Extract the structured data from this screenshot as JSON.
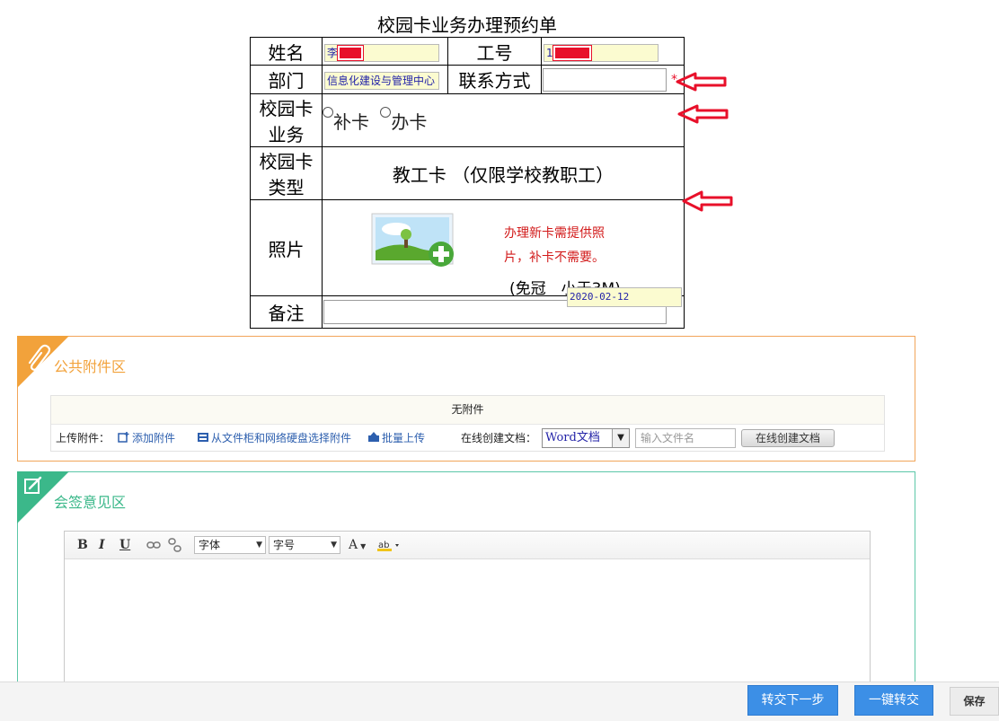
{
  "form": {
    "title": "校园卡业务办理预约单",
    "name_label": "姓名",
    "name_value": "李",
    "id_label": "工号",
    "id_value": "1",
    "dept_label": "部门",
    "dept_value": "信息化建设与管理中心",
    "contact_label": "联系方式",
    "contact_value": "",
    "required_mark": "*",
    "business_label": "校园卡业务",
    "business_options": [
      "补卡",
      "办卡"
    ],
    "type_label": "校园卡类型",
    "type_value": "教工卡 （仅限学校教职工）",
    "photo_label": "照片",
    "photo_note_line1": "办理新卡需提供照",
    "photo_note_line2": "片，补卡不需要。",
    "photo_hint": "(免冠　小于3M)",
    "remark_label": "备注",
    "remark_value": "",
    "date_value": "2020-02-12"
  },
  "attachments": {
    "section_title": "公共附件区",
    "empty_text": "无附件",
    "upload_label": "上传附件：",
    "add_link": "添加附件",
    "cabinet_link": "从文件柜和网络硬盘选择附件",
    "batch_link": "批量上传",
    "online_label": "在线创建文档：",
    "doc_type_selected": "Word文档",
    "filename_placeholder": "输入文件名",
    "create_button": "在线创建文档"
  },
  "sign": {
    "section_title": "会签意见区",
    "toolbar": {
      "bold": "B",
      "italic": "I",
      "underline": "U",
      "font_select": "字体",
      "size_select": "字号",
      "font_color": "A"
    },
    "editor_content": ""
  },
  "footer": {
    "next_button": "转交下一步",
    "one_click_button": "一键转交",
    "save_button": "保存"
  },
  "colors": {
    "attach_accent": "#f2a55a",
    "sign_accent": "#3bb88a",
    "button_blue": "#3c8fe6",
    "required_red": "#e8102a"
  }
}
